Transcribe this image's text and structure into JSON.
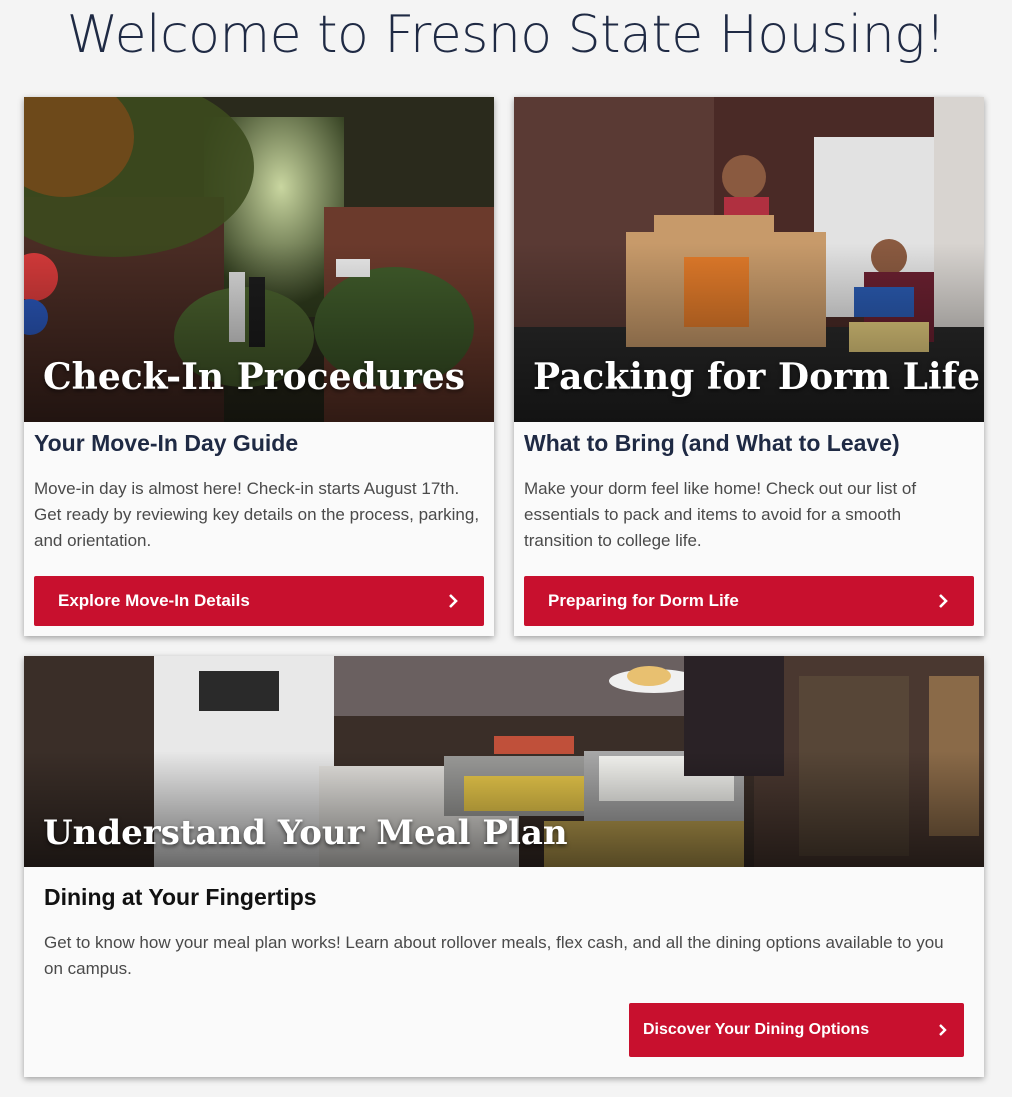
{
  "page": {
    "title": "Welcome to Fresno State Housing!"
  },
  "colors": {
    "accent": "#c8102e",
    "heading": "#1f2a44"
  },
  "cards": [
    {
      "hero_title": "Check-In Procedures",
      "subtitle": "Your Move-In Day Guide",
      "text": "Move-in day is almost here! Check-in starts August 17th. Get ready by reviewing key details on the process, parking, and orientation.",
      "button": "Explore Move-In Details",
      "icon": "chevron-right-icon"
    },
    {
      "hero_title": "Packing for Dorm Life",
      "subtitle": "What to Bring (and What to Leave)",
      "text": "Make your dorm feel like home! Check out our list of essentials to pack and items to avoid for a smooth transition to college life.",
      "button": "Preparing for Dorm Life",
      "icon": "chevron-right-icon"
    },
    {
      "hero_title": "Understand Your Meal Plan",
      "subtitle": "Dining at Your Fingertips",
      "text": "Get to know how your meal plan works! Learn about rollover meals, flex cash, and all the dining options available to you on campus.",
      "button": "Discover Your Dining Options",
      "icon": "chevron-right-icon"
    }
  ]
}
